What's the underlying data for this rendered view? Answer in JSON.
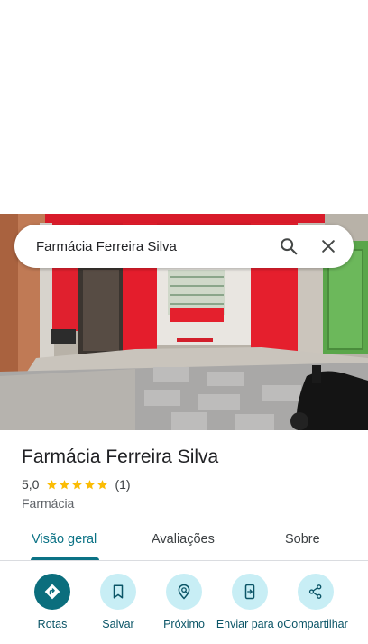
{
  "search": {
    "query": "Farmácia Ferreira Silva"
  },
  "place": {
    "name": "Farmácia Ferreira Silva",
    "rating": "5,0",
    "stars": 5,
    "review_count": "(1)",
    "category": "Farmácia"
  },
  "tabs": [
    {
      "label": "Visão geral",
      "active": true
    },
    {
      "label": "Avaliações",
      "active": false
    },
    {
      "label": "Sobre",
      "active": false
    }
  ],
  "actions": [
    {
      "label": "Rotas",
      "icon": "directions-icon"
    },
    {
      "label": "Salvar",
      "icon": "bookmark-icon"
    },
    {
      "label": "Próximo",
      "icon": "nearby-icon"
    },
    {
      "label": "Enviar para o",
      "icon": "send-to-phone-icon"
    },
    {
      "label": "Compartilhar",
      "icon": "share-icon"
    }
  ],
  "colors": {
    "accent": "#0b7285",
    "primary_action": "#0b6e7d",
    "action_bg": "#c8eef5",
    "star": "#fbbc04"
  }
}
